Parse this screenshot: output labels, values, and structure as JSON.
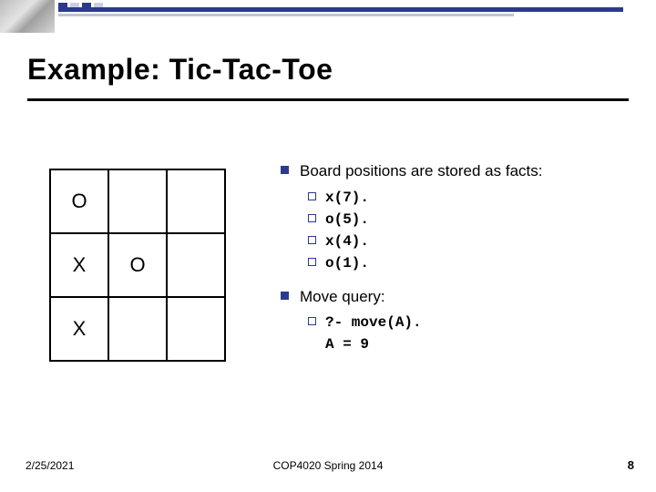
{
  "title": "Example: Tic-Tac-Toe",
  "board": {
    "cells": [
      "O",
      "",
      "",
      "X",
      "O",
      "",
      "X",
      "",
      ""
    ]
  },
  "bullets": {
    "b1_text": "Board positions are stored as facts:",
    "facts": [
      "x(7).",
      "o(5).",
      "x(4).",
      "o(1)."
    ],
    "b2_text": "Move query:",
    "query_line1": "?- move(A).",
    "query_line2": "A = 9"
  },
  "footer": {
    "date": "2/25/2021",
    "center": "COP4020 Spring 2014",
    "page": "8"
  }
}
